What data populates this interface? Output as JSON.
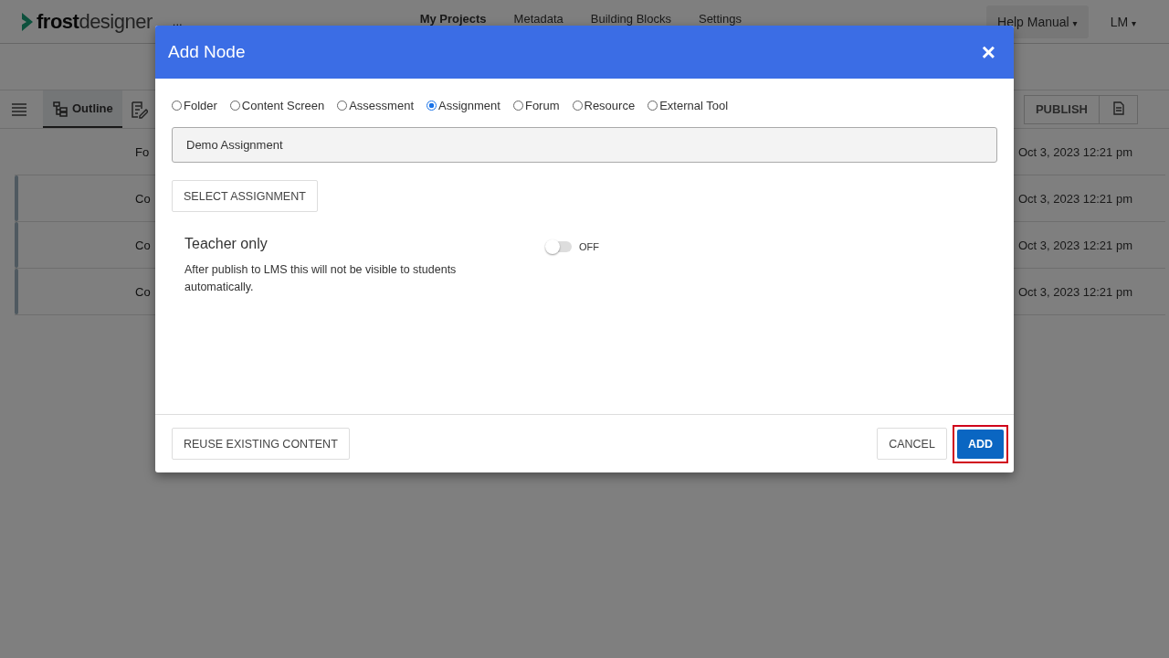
{
  "header": {
    "logo": {
      "bold": "frost",
      "light": "designer"
    },
    "more": "...",
    "nav": [
      {
        "label": "My Projects",
        "selected": true
      },
      {
        "label": "Metadata",
        "selected": false
      },
      {
        "label": "Building Blocks",
        "selected": false
      },
      {
        "label": "Settings",
        "selected": false
      }
    ],
    "help": "Help Manual",
    "help_caret": "▾",
    "user": "LM",
    "user_caret": "▾"
  },
  "toolbar": {
    "tabs": [
      {
        "label": "Outline",
        "selected": true
      }
    ],
    "publish": "PUBLISH"
  },
  "rows": [
    {
      "name": "Fo",
      "date": "Oct 3, 2023 12:21 pm",
      "nested": false
    },
    {
      "name": "Co",
      "date": "Oct 3, 2023 12:21 pm",
      "nested": true
    },
    {
      "name": "Co",
      "date": "Oct 3, 2023 12:21 pm",
      "nested": true
    },
    {
      "name": "Co",
      "date": "Oct 3, 2023 12:21 pm",
      "nested": true
    }
  ],
  "dialog": {
    "title": "Add Node",
    "close": "×",
    "types": [
      {
        "label": "Folder",
        "selected": false
      },
      {
        "label": "Content Screen",
        "selected": false
      },
      {
        "label": "Assessment",
        "selected": false
      },
      {
        "label": "Assignment",
        "selected": true
      },
      {
        "label": "Forum",
        "selected": false
      },
      {
        "label": "Resource",
        "selected": false
      },
      {
        "label": "External Tool",
        "selected": false
      }
    ],
    "name_value": "Demo Assignment",
    "select_button": "SELECT ASSIGNMENT",
    "teacher_only": {
      "title": "Teacher only",
      "description": "After publish to LMS this will not be visible to students automatically.",
      "on": false,
      "state_label": "OFF"
    },
    "reuse_button": "REUSE EXISTING CONTENT",
    "cancel_button": "CANCEL",
    "add_button": {
      "label": "ADD",
      "highlighted": true
    }
  }
}
